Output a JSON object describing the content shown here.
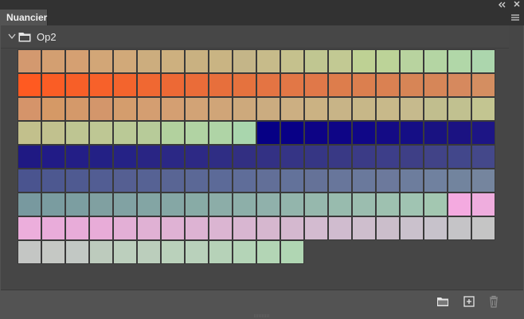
{
  "panel": {
    "tab_label": "Nuancier",
    "group_name": "Op2"
  },
  "icons": {
    "collapse": "double-chevron-icon",
    "close": "close-icon",
    "menu": "menu-icon",
    "group_toggle": "chevron-down-icon",
    "folder": "folder-icon",
    "new_group": "folder-icon",
    "new_swatch": "plus-square-icon",
    "delete": "trash-icon"
  },
  "swatches": [
    "#d3996f",
    "#d39f71",
    "#d5a072",
    "#d2a677",
    "#d1a979",
    "#ccad7e",
    "#cdb07f",
    "#c9b181",
    "#c9b483",
    "#c4b588",
    "#c7bb8a",
    "#c5c18d",
    "#c0c691",
    "#c2c993",
    "#bed194",
    "#bcd398",
    "#b8d39f",
    "#b4d5a3",
    "#b1d7a8",
    "#acd6ad",
    "#ff5a21",
    "#fa5d25",
    "#f75f28",
    "#f7612a",
    "#f3642d",
    "#f06832",
    "#ed6935",
    "#ea6c39",
    "#e76f3c",
    "#e5723e",
    "#e47443",
    "#e27746",
    "#e07849",
    "#dd7d4c",
    "#db7f4f",
    "#da8152",
    "#d78556",
    "#d68658",
    "#d6895e",
    "#d48e61",
    "#d5946a",
    "#d59966",
    "#d4996a",
    "#d3966b",
    "#d49d6d",
    "#d49e71",
    "#d49f72",
    "#d2a376",
    "#d0a578",
    "#cda97c",
    "#cbac80",
    "#ccaf82",
    "#cbb283",
    "#c8b487",
    "#c7b788",
    "#c8b98a",
    "#c6ba8d",
    "#c1be8e",
    "#c1c190",
    "#c3c591",
    "#c2c08c",
    "#c1c18e",
    "#bec592",
    "#bec794",
    "#bac996",
    "#b7cb99",
    "#b2d19e",
    "#b1d3a3",
    "#afd4a6",
    "#a9d6ad",
    "#060085",
    "#080086",
    "#0d0385",
    "#0e0586",
    "#100787",
    "#140b85",
    "#150e85",
    "#191281",
    "#1b1282",
    "#1d1585",
    "#1f1983",
    "#211b86",
    "#231e86",
    "#232085",
    "#252286",
    "#292584",
    "#2b2885",
    "#2d2985",
    "#2f2d84",
    "#322f82",
    "#333184",
    "#353485",
    "#363684",
    "#393985",
    "#3b3b86",
    "#3d3e89",
    "#3e3f86",
    "#414387",
    "#42478b",
    "#44488a",
    "#4a548f",
    "#4d5890",
    "#4f5a91",
    "#525d93",
    "#555f92",
    "#566294",
    "#596594",
    "#5b6896",
    "#5c6a98",
    "#5f6d99",
    "#626f98",
    "#63729a",
    "#657298",
    "#68769b",
    "#6a799c",
    "#6c799c",
    "#6d7d9d",
    "#70819f",
    "#72849e",
    "#75859e",
    "#78999f",
    "#7a9ca0",
    "#7c9ea1",
    "#80a0a1",
    "#81a2a3",
    "#83a5a4",
    "#85a7a5",
    "#88aba6",
    "#8cada8",
    "#8dafa9",
    "#90b1ab",
    "#93b5ac",
    "#96b8ad",
    "#98bbae",
    "#9bbdaf",
    "#9ec1b0",
    "#a0c4b2",
    "#a3c7b1",
    "#f4aae0",
    "#efadde",
    "#ecaedc",
    "#e9acda",
    "#e8acd9",
    "#e8acd8",
    "#e3afd6",
    "#e0b1d4",
    "#dfb2d4",
    "#ddb3d3",
    "#dbb5d2",
    "#d8b6d1",
    "#d6b7cf",
    "#d4b8cf",
    "#d3bbd0",
    "#d0bccf",
    "#cebecd",
    "#cbbecb",
    "#cac1cc",
    "#c7c2cb",
    "#c5c4c7",
    "#c5c5c5",
    "#c4c6c4",
    "#c5c8c4",
    "#c2c8c4",
    "#bdcbbd",
    "#bccfbd",
    "#bbcebc",
    "#bad1bb",
    "#b9d1bb",
    "#b6d2b8",
    "#b4d4b7",
    "#b3d5b5",
    "#b0d6b3"
  ]
}
